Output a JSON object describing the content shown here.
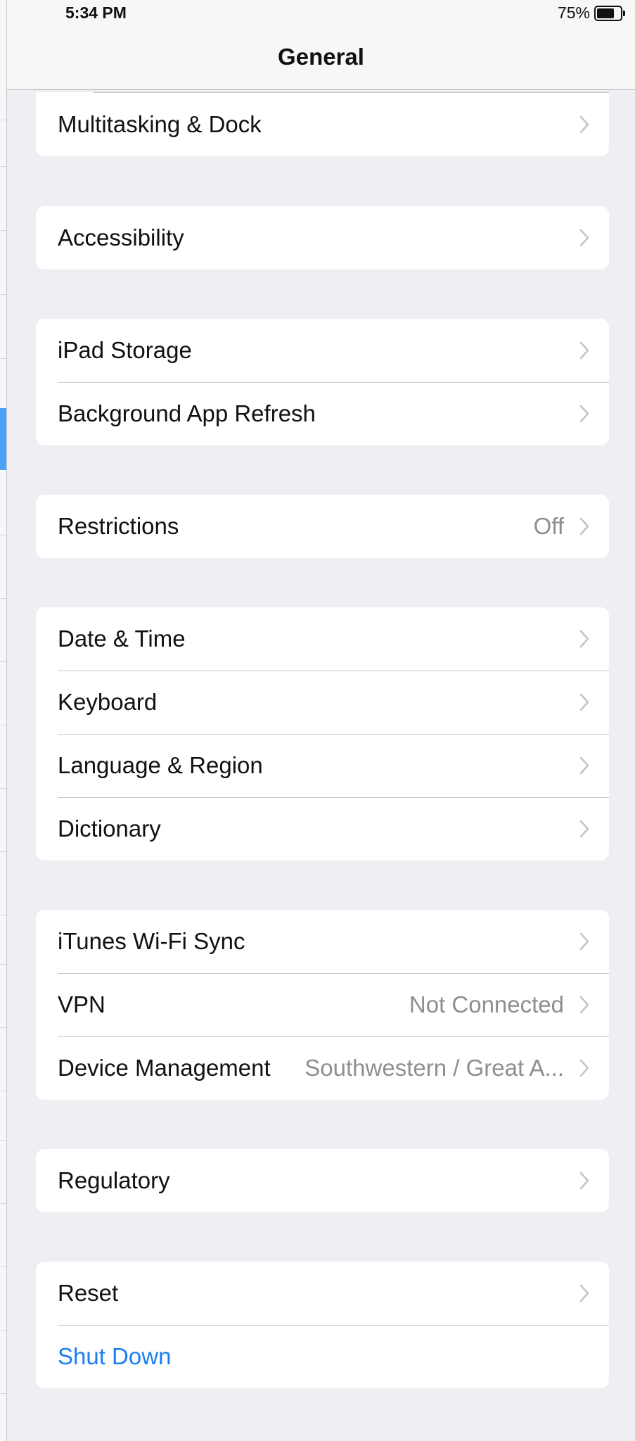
{
  "status_bar": {
    "time": "5:34 PM",
    "battery_percent": "75%",
    "battery_level": 0.75
  },
  "nav": {
    "title": "General"
  },
  "icons": {
    "chevron": "chevron-right-icon",
    "battery": "battery-icon"
  },
  "colors": {
    "link": "#1a7ef0",
    "background": "#eeeef3",
    "value_text": "#8e8e93"
  },
  "groups": [
    {
      "rows": [
        {
          "label": "Multitasking & Dock"
        }
      ]
    },
    {
      "rows": [
        {
          "label": "Accessibility"
        }
      ]
    },
    {
      "rows": [
        {
          "label": "iPad Storage"
        },
        {
          "label": "Background App Refresh"
        }
      ]
    },
    {
      "rows": [
        {
          "label": "Restrictions",
          "value": "Off"
        }
      ]
    },
    {
      "rows": [
        {
          "label": "Date & Time"
        },
        {
          "label": "Keyboard"
        },
        {
          "label": "Language & Region"
        },
        {
          "label": "Dictionary"
        }
      ]
    },
    {
      "rows": [
        {
          "label": "iTunes Wi-Fi Sync"
        },
        {
          "label": "VPN",
          "value": "Not Connected"
        },
        {
          "label": "Device Management",
          "value": "Southwestern / Great A..."
        }
      ]
    },
    {
      "rows": [
        {
          "label": "Regulatory"
        }
      ]
    },
    {
      "rows": [
        {
          "label": "Reset"
        },
        {
          "label": "Shut Down"
        }
      ]
    }
  ]
}
